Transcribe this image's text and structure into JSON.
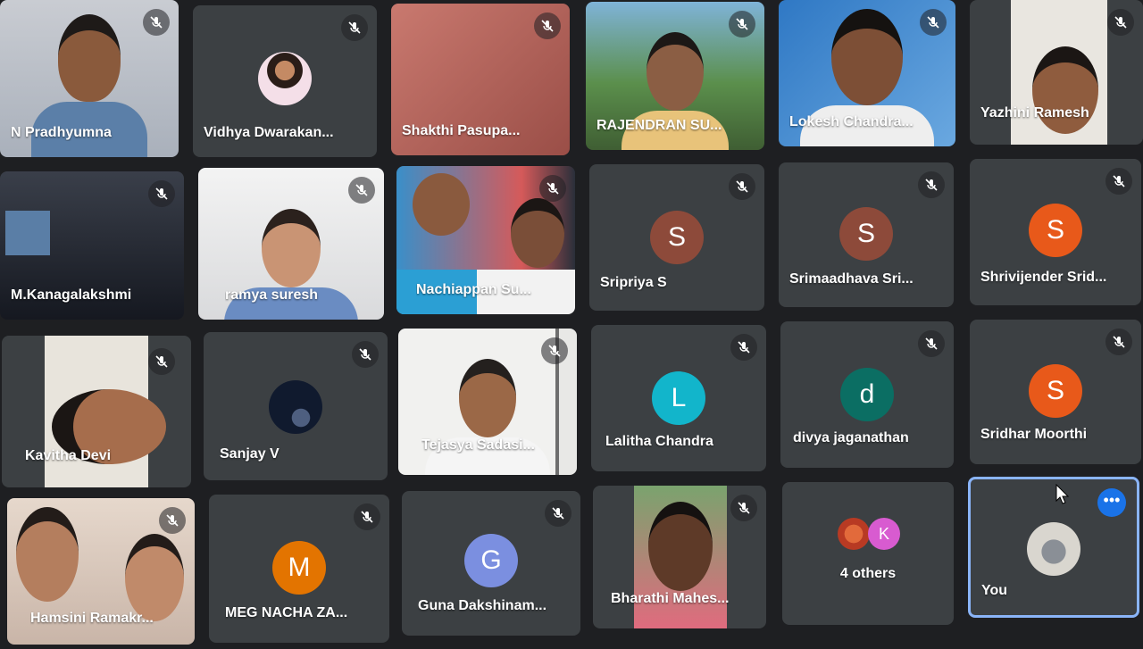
{
  "meeting": {
    "tiles": [
      {
        "name": "N Pradhyumna"
      },
      {
        "name": "Vidhya Dwarakan..."
      },
      {
        "name": "Shakthi Pasupa..."
      },
      {
        "name": "RAJENDRAN SU..."
      },
      {
        "name": "Lokesh Chandra..."
      },
      {
        "name": "Yazhini Ramesh"
      },
      {
        "name": "M.Kanagalakshmi"
      },
      {
        "name": "ramya suresh"
      },
      {
        "name": "Nachiappan Su..."
      },
      {
        "name": "Sripriya S",
        "initial": "S",
        "color": "#8d4a3a"
      },
      {
        "name": "Srimaadhava Sri...",
        "initial": "S",
        "color": "#8d4a3a"
      },
      {
        "name": "Shrivijender Srid...",
        "initial": "S",
        "color": "#e8591a"
      },
      {
        "name": "Kavitha Devi"
      },
      {
        "name": "Sanjay V"
      },
      {
        "name": "Tejasya Sadasi..."
      },
      {
        "name": "Lalitha Chandra",
        "initial": "L",
        "color": "#12b5cb"
      },
      {
        "name": "divya jaganathan",
        "initial": "d",
        "color": "#0b6e63"
      },
      {
        "name": "Sridhar Moorthi",
        "initial": "S",
        "color": "#e8591a"
      },
      {
        "name": "Hamsini Ramakr..."
      },
      {
        "name": "MEG NACHA ZA...",
        "initial": "M",
        "color": "#e37400"
      },
      {
        "name": "Guna Dakshinam...",
        "initial": "G",
        "color": "#7b8fe0"
      },
      {
        "name": "Bharathi Mahes..."
      },
      {
        "name": "4 others",
        "initial": "K",
        "color": "#d85bd0"
      },
      {
        "name": "You"
      }
    ],
    "more_options": "•••"
  }
}
